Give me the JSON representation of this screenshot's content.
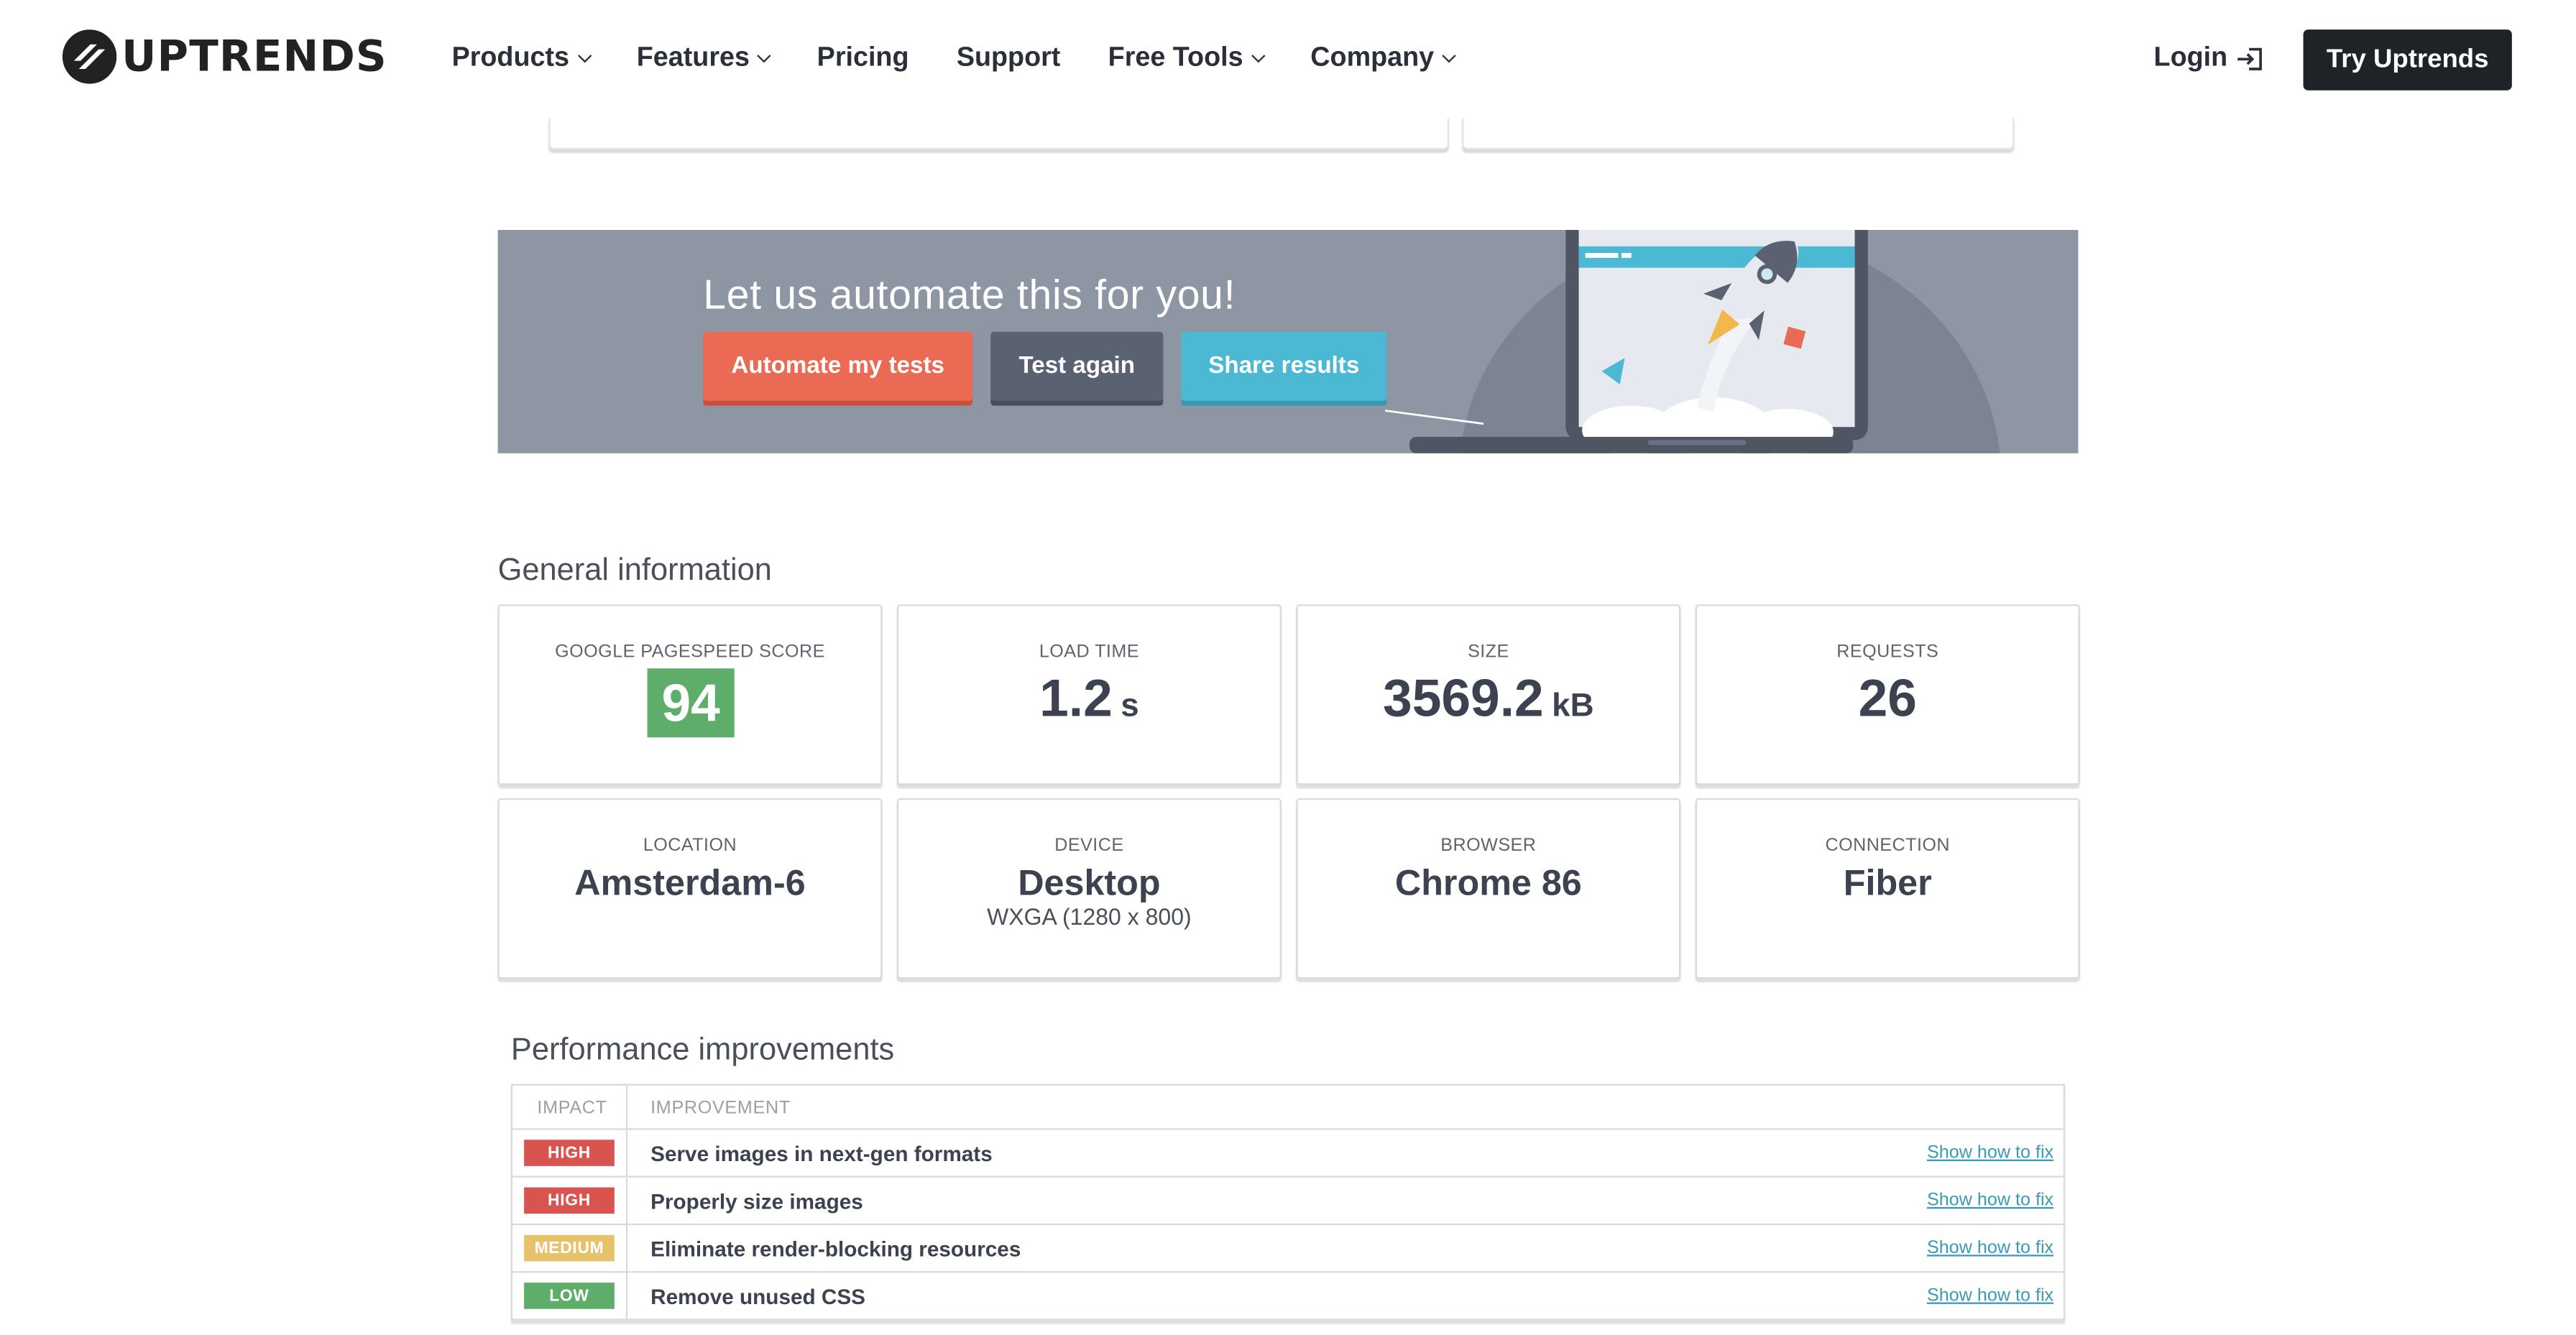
{
  "nav": {
    "logo_text": "UPTRENDS",
    "menu": [
      {
        "label": "Products",
        "dropdown": true
      },
      {
        "label": "Features",
        "dropdown": true
      },
      {
        "label": "Pricing",
        "dropdown": false
      },
      {
        "label": "Support",
        "dropdown": false
      },
      {
        "label": "Free Tools",
        "dropdown": true
      },
      {
        "label": "Company",
        "dropdown": true
      }
    ],
    "login_label": "Login",
    "try_label": "Try Uptrends"
  },
  "banner": {
    "title": "Let us automate this for you!",
    "automate_label": "Automate my tests",
    "test_again_label": "Test again",
    "share_label": "Share results"
  },
  "general": {
    "title": "General information",
    "pagespeed": {
      "label": "GOOGLE PAGESPEED SCORE",
      "value": "94"
    },
    "load_time": {
      "label": "LOAD TIME",
      "value": "1.2",
      "unit": "s"
    },
    "size": {
      "label": "SIZE",
      "value": "3569.2",
      "unit": "kB"
    },
    "requests": {
      "label": "REQUESTS",
      "value": "26"
    },
    "location": {
      "label": "LOCATION",
      "value": "Amsterdam-6"
    },
    "device": {
      "label": "DEVICE",
      "value": "Desktop",
      "sub": "WXGA (1280 x 800)"
    },
    "browser": {
      "label": "BROWSER",
      "value": "Chrome 86"
    },
    "connection": {
      "label": "CONNECTION",
      "value": "Fiber"
    }
  },
  "performance": {
    "title": "Performance improvements",
    "headers": {
      "impact": "IMPACT",
      "improvement": "IMPROVEMENT"
    },
    "rows": [
      {
        "impact": "HIGH",
        "improvement": "Serve images in next-gen formats",
        "link": "Show how to fix"
      },
      {
        "impact": "HIGH",
        "improvement": "Properly size images",
        "link": "Show how to fix"
      },
      {
        "impact": "MEDIUM",
        "improvement": "Eliminate render-blocking resources",
        "link": "Show how to fix"
      },
      {
        "impact": "LOW",
        "improvement": "Remove unused CSS",
        "link": "Show how to fix"
      }
    ]
  },
  "colors": {
    "high": "#d9534f",
    "medium": "#e8c26a",
    "low": "#5fad6a",
    "score_good": "#5fad6a",
    "banner_bg": "#8e96a4"
  }
}
